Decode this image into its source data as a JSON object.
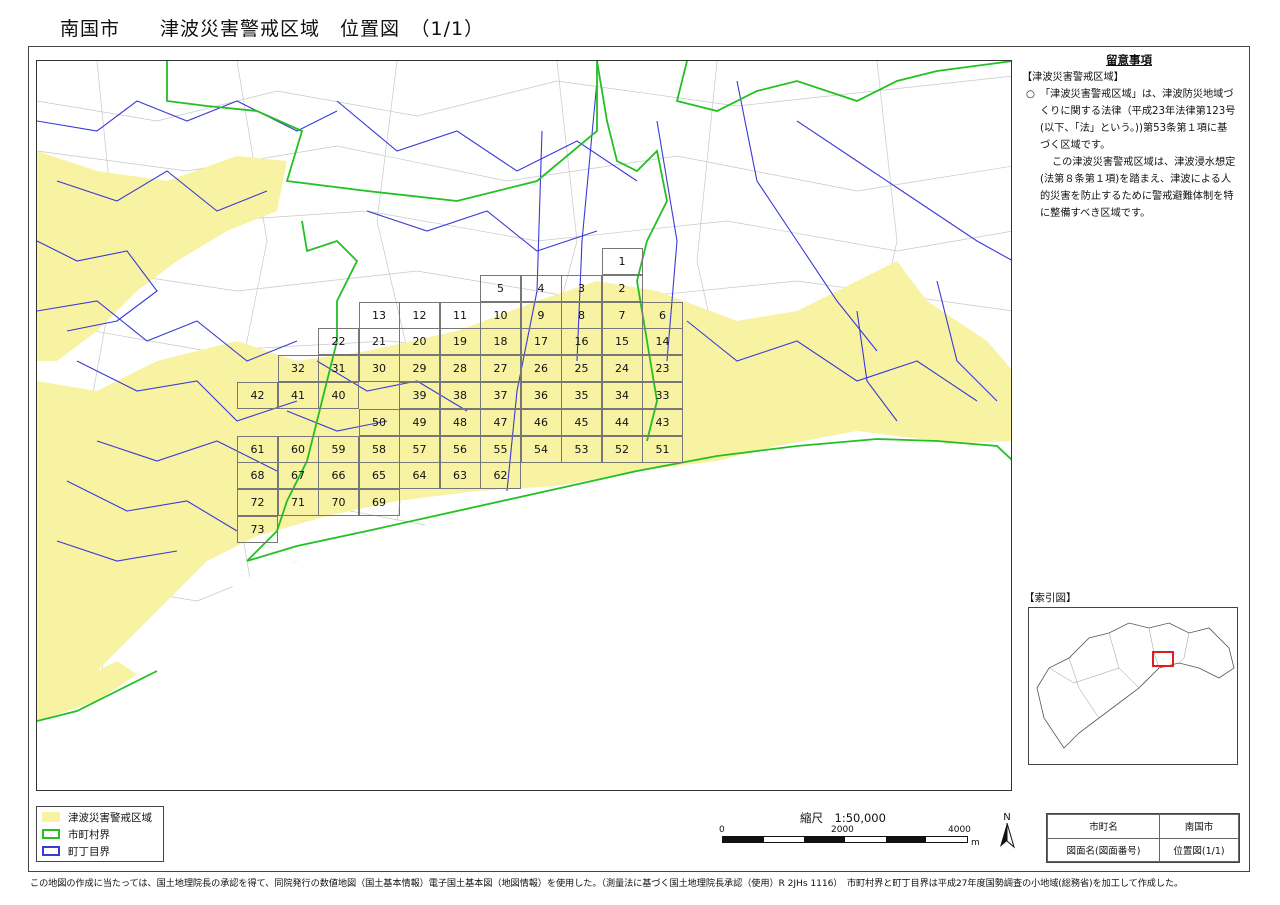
{
  "title": "南国市　　津波災害警戒区域　位置図　（1/1）",
  "colors": {
    "zone": "#f7f3a3",
    "city_border": "#22c022",
    "town_border": "#3a3ad6",
    "index_marker": "#e11d1d"
  },
  "grid_cells": [
    {
      "label": "1",
      "col": 14,
      "row": 0
    },
    {
      "label": "5",
      "col": 11,
      "row": 1
    },
    {
      "label": "4",
      "col": 12,
      "row": 1
    },
    {
      "label": "3",
      "col": 13,
      "row": 1
    },
    {
      "label": "2",
      "col": 14,
      "row": 1
    },
    {
      "label": "13",
      "col": 8,
      "row": 2
    },
    {
      "label": "12",
      "col": 9,
      "row": 2
    },
    {
      "label": "11",
      "col": 10,
      "row": 2
    },
    {
      "label": "10",
      "col": 11,
      "row": 2
    },
    {
      "label": "9",
      "col": 12,
      "row": 2
    },
    {
      "label": "8",
      "col": 13,
      "row": 2
    },
    {
      "label": "7",
      "col": 14,
      "row": 2
    },
    {
      "label": "6",
      "col": 15,
      "row": 2
    },
    {
      "label": "22",
      "col": 7,
      "row": 3
    },
    {
      "label": "21",
      "col": 8,
      "row": 3
    },
    {
      "label": "20",
      "col": 9,
      "row": 3
    },
    {
      "label": "19",
      "col": 10,
      "row": 3
    },
    {
      "label": "18",
      "col": 11,
      "row": 3
    },
    {
      "label": "17",
      "col": 12,
      "row": 3
    },
    {
      "label": "16",
      "col": 13,
      "row": 3
    },
    {
      "label": "15",
      "col": 14,
      "row": 3
    },
    {
      "label": "14",
      "col": 15,
      "row": 3
    },
    {
      "label": "32",
      "col": 6,
      "row": 4
    },
    {
      "label": "31",
      "col": 7,
      "row": 4
    },
    {
      "label": "30",
      "col": 8,
      "row": 4
    },
    {
      "label": "29",
      "col": 9,
      "row": 4
    },
    {
      "label": "28",
      "col": 10,
      "row": 4
    },
    {
      "label": "27",
      "col": 11,
      "row": 4
    },
    {
      "label": "26",
      "col": 12,
      "row": 4
    },
    {
      "label": "25",
      "col": 13,
      "row": 4
    },
    {
      "label": "24",
      "col": 14,
      "row": 4
    },
    {
      "label": "23",
      "col": 15,
      "row": 4
    },
    {
      "label": "42",
      "col": 5,
      "row": 5
    },
    {
      "label": "41",
      "col": 6,
      "row": 5
    },
    {
      "label": "40",
      "col": 7,
      "row": 5
    },
    {
      "label": "39",
      "col": 9,
      "row": 5
    },
    {
      "label": "38",
      "col": 10,
      "row": 5
    },
    {
      "label": "37",
      "col": 11,
      "row": 5
    },
    {
      "label": "36",
      "col": 12,
      "row": 5
    },
    {
      "label": "35",
      "col": 13,
      "row": 5
    },
    {
      "label": "34",
      "col": 14,
      "row": 5
    },
    {
      "label": "33",
      "col": 15,
      "row": 5
    },
    {
      "label": "50",
      "col": 8,
      "row": 6
    },
    {
      "label": "49",
      "col": 9,
      "row": 6
    },
    {
      "label": "48",
      "col": 10,
      "row": 6
    },
    {
      "label": "47",
      "col": 11,
      "row": 6
    },
    {
      "label": "46",
      "col": 12,
      "row": 6
    },
    {
      "label": "45",
      "col": 13,
      "row": 6
    },
    {
      "label": "44",
      "col": 14,
      "row": 6
    },
    {
      "label": "43",
      "col": 15,
      "row": 6
    },
    {
      "label": "61",
      "col": 5,
      "row": 7
    },
    {
      "label": "60",
      "col": 6,
      "row": 7
    },
    {
      "label": "59",
      "col": 7,
      "row": 7
    },
    {
      "label": "58",
      "col": 8,
      "row": 7
    },
    {
      "label": "57",
      "col": 9,
      "row": 7
    },
    {
      "label": "56",
      "col": 10,
      "row": 7
    },
    {
      "label": "55",
      "col": 11,
      "row": 7
    },
    {
      "label": "54",
      "col": 12,
      "row": 7
    },
    {
      "label": "53",
      "col": 13,
      "row": 7
    },
    {
      "label": "52",
      "col": 14,
      "row": 7
    },
    {
      "label": "51",
      "col": 15,
      "row": 7
    },
    {
      "label": "68",
      "col": 5,
      "row": 8
    },
    {
      "label": "67",
      "col": 6,
      "row": 8
    },
    {
      "label": "66",
      "col": 7,
      "row": 8
    },
    {
      "label": "65",
      "col": 8,
      "row": 8
    },
    {
      "label": "64",
      "col": 9,
      "row": 8
    },
    {
      "label": "63",
      "col": 10,
      "row": 8
    },
    {
      "label": "62",
      "col": 11,
      "row": 8
    },
    {
      "label": "72",
      "col": 5,
      "row": 9
    },
    {
      "label": "71",
      "col": 6,
      "row": 9
    },
    {
      "label": "70",
      "col": 7,
      "row": 9
    },
    {
      "label": "69",
      "col": 8,
      "row": 9
    },
    {
      "label": "73",
      "col": 5,
      "row": 10
    }
  ],
  "notes": {
    "heading": "留意事項",
    "section": "【津波災害警戒区域】",
    "para1": "○　「津波災害警戒区域」は、津波防災地域づくりに関する法律（平成23年法律第123号(以下、「法」という。))第53条第１項に基づく区域です。",
    "para2": "この津波災害警戒区域は、津波浸水想定(法第８条第１項)を踏まえ、津波による人的災害を防止するために警戒避難体制を特に整備すべき区域です。"
  },
  "index_label": "【索引図】",
  "legend": [
    {
      "label": "津波災害警戒区域",
      "color": "#f7f3a3",
      "kind": "fill"
    },
    {
      "label": "市町村界",
      "color": "#22c022",
      "kind": "line"
    },
    {
      "label": "町丁目界",
      "color": "#3a3ad6",
      "kind": "line"
    }
  ],
  "scale": {
    "title": "縮尺　1:50,000",
    "ticks": [
      "0",
      "2000",
      "4000"
    ],
    "unit": "m"
  },
  "north": "N",
  "info_table": [
    [
      "市町名",
      "南国市"
    ],
    [
      "図面名(図面番号)",
      "位置図(1/1)"
    ]
  ],
  "footer": "この地図の作成に当たっては、国土地理院長の承認を得て、同院発行の数値地図（国土基本情報）電子国土基本図（地図情報）を使用した。（測量法に基づく国土地理院長承認（使用）R 2JHs 1116）　市町村界と町丁目界は平成27年度国勢調査の小地域(総務省)を加工して作成した。"
}
